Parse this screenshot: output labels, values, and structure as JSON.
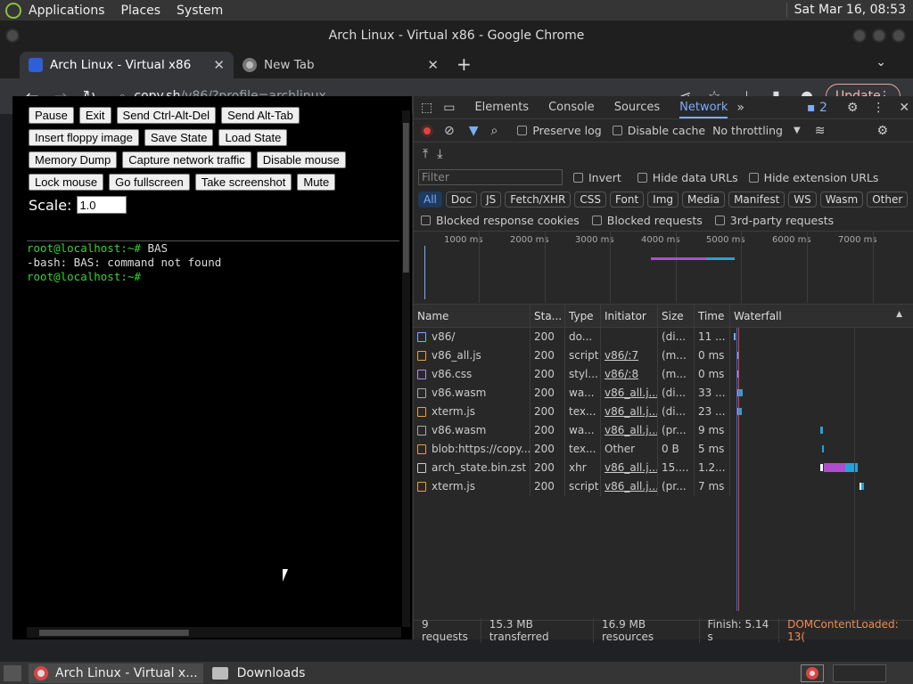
{
  "topbar": {
    "menus": [
      "Applications",
      "Places",
      "System"
    ],
    "clock": "Sat Mar 16, 08:53"
  },
  "window": {
    "title": "Arch Linux - Virtual x86 - Google Chrome"
  },
  "tabs": [
    {
      "label": "Arch Linux - Virtual x86",
      "close": "✕"
    },
    {
      "label": "New Tab",
      "close": "✕"
    }
  ],
  "toolbar": {
    "url_host": "copy.sh",
    "url_path": "/v86/?profile=archlinux",
    "update_label": "Update"
  },
  "v86": {
    "buttons_row1": [
      "Pause",
      "Exit",
      "Send Ctrl-Alt-Del",
      "Send Alt-Tab"
    ],
    "buttons_row2": [
      "Insert floppy image",
      "Save State",
      "Load State"
    ],
    "buttons_row3": [
      "Memory Dump",
      "Capture network traffic",
      "Disable mouse"
    ],
    "buttons_row4": [
      "Lock mouse",
      "Go fullscreen",
      "Take screenshot",
      "Mute"
    ],
    "scale_label": "Scale:",
    "scale_value": "1.0",
    "terminal": {
      "line1_prompt": "root@localhost:~#",
      "line1_cmd": " BAS",
      "line2": "-bash: BAS: command not found",
      "line3_prompt": "root@localhost:~#"
    }
  },
  "devtools": {
    "tabs": [
      "Elements",
      "Console",
      "Sources",
      "Network"
    ],
    "active_tab": "Network",
    "issues_count": "2",
    "preserve_log": "Preserve log",
    "disable_cache": "Disable cache",
    "throttling": "No throttling",
    "filter_placeholder": "Filter",
    "invert": "Invert",
    "hide_data_urls": "Hide data URLs",
    "hide_ext_urls": "Hide extension URLs",
    "types": [
      "All",
      "Doc",
      "JS",
      "Fetch/XHR",
      "CSS",
      "Font",
      "Img",
      "Media",
      "Manifest",
      "WS",
      "Wasm",
      "Other"
    ],
    "blocked_cookies": "Blocked response cookies",
    "blocked_requests": "Blocked requests",
    "third_party": "3rd-party requests",
    "overview_ticks": [
      "1000 ms",
      "2000 ms",
      "3000 ms",
      "4000 ms",
      "5000 ms",
      "6000 ms",
      "7000 ms"
    ],
    "columns": [
      "Name",
      "Sta...",
      "Type",
      "Initiator",
      "Size",
      "Time",
      "Waterfall"
    ],
    "requests": [
      {
        "name": "v86/",
        "status": "200",
        "type": "do...",
        "initiator": "",
        "size": "(di...",
        "time": "11 ...",
        "icon": "doc"
      },
      {
        "name": "v86_all.js",
        "status": "200",
        "type": "script",
        "initiator": "v86/:7",
        "size": "(m...",
        "time": "0 ms",
        "icon": "js"
      },
      {
        "name": "v86.css",
        "status": "200",
        "type": "styl...",
        "initiator": "v86/:8",
        "size": "(m...",
        "time": "0 ms",
        "icon": "css"
      },
      {
        "name": "v86.wasm",
        "status": "200",
        "type": "wa...",
        "initiator": "v86_all.j...",
        "size": "(di...",
        "time": "33 ...",
        "icon": "wasm"
      },
      {
        "name": "xterm.js",
        "status": "200",
        "type": "tex...",
        "initiator": "v86_all.j...",
        "size": "(di...",
        "time": "23 ...",
        "icon": "js"
      },
      {
        "name": "v86.wasm",
        "status": "200",
        "type": "wa...",
        "initiator": "v86_all.j...",
        "size": "(pr...",
        "time": "9 ms",
        "icon": "wasm"
      },
      {
        "name": "blob:https://copy....",
        "status": "200",
        "type": "tex...",
        "initiator": "Other",
        "size": "0 B",
        "time": "5 ms",
        "icon": "js"
      },
      {
        "name": "arch_state.bin.zst",
        "status": "200",
        "type": "xhr",
        "initiator": "v86_all.j...",
        "size": "15....",
        "time": "1.2...",
        "icon": "blank"
      },
      {
        "name": "xterm.js",
        "status": "200",
        "type": "script",
        "initiator": "v86_all.j...",
        "size": "(pr...",
        "time": "7 ms",
        "icon": "js"
      }
    ],
    "status": {
      "requests": "9 requests",
      "transferred": "15.3 MB transferred",
      "resources": "16.9 MB resources",
      "finish": "Finish: 5.14 s",
      "dcl": "DOMContentLoaded: 13("
    }
  },
  "taskbar": {
    "items": [
      "Arch Linux - Virtual x...",
      "Downloads"
    ]
  },
  "colors": {
    "accent": "#7cacf8",
    "terminal_green": "#38d430",
    "dcl_orange": "#f28b54"
  }
}
